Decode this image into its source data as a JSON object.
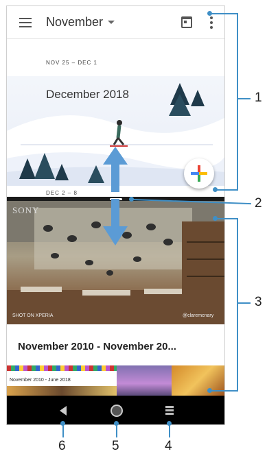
{
  "calendar": {
    "month_label": "November",
    "week_range_1": "NOV 25 – DEC 1",
    "banner_title": "December 2018",
    "week_range_2": "DEC 2 – 8"
  },
  "photos": {
    "watermark_brand": "SONY",
    "watermark_camera": "SHOT ON XPERIA",
    "photo_credit": "@claremcnary",
    "album_title": "November 2010 - November 20...",
    "thumb_label": "November 2010 - June 2018"
  },
  "callouts": {
    "c1": "1",
    "c2": "2",
    "c3": "3",
    "c4": "4",
    "c5": "5",
    "c6": "6"
  },
  "colors": {
    "callout_line": "#3f8fc6",
    "arrow": "#5b9bd5",
    "nav_bar": "#000000"
  },
  "icons": [
    "menu-icon",
    "caret-down-icon",
    "today-icon",
    "more-vert-icon",
    "add-icon",
    "back-icon",
    "home-icon",
    "recents-icon"
  ]
}
